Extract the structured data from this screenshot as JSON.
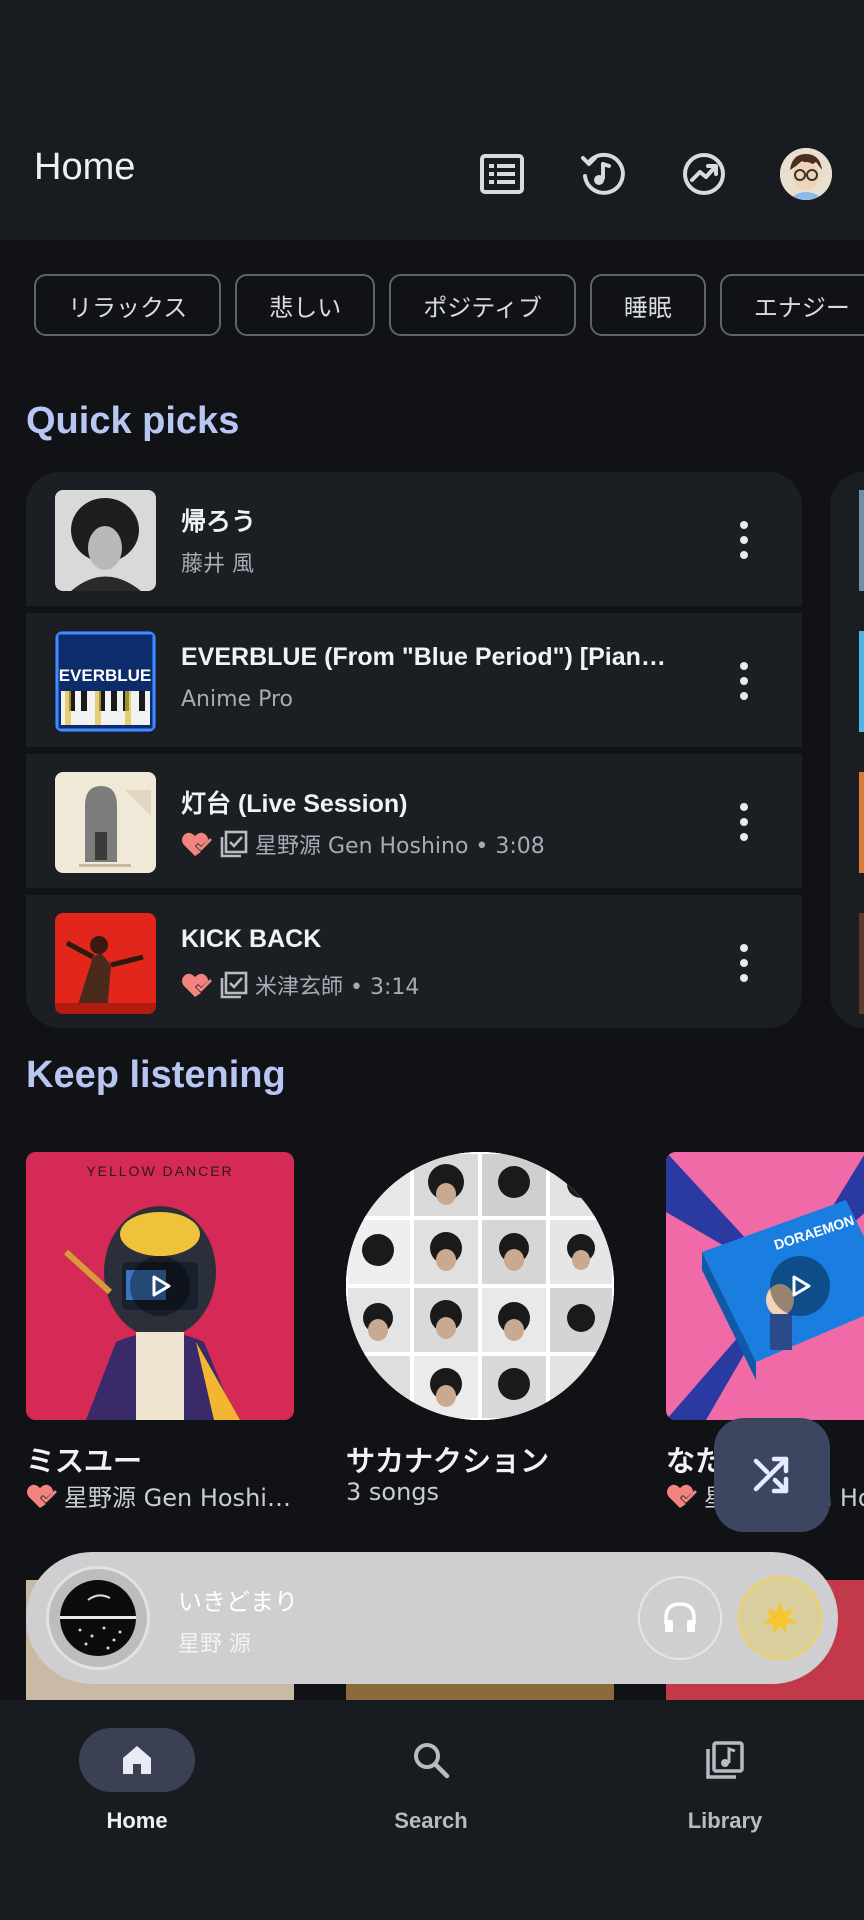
{
  "header": {
    "title": "Home",
    "icons": [
      "list-icon",
      "history-icon",
      "trending-icon",
      "avatar"
    ]
  },
  "chips": [
    "リラックス",
    "悲しい",
    "ポジティブ",
    "睡眠",
    "エナジー"
  ],
  "quick_picks": {
    "title": "Quick picks",
    "rows": [
      {
        "title": "帰ろう",
        "subtitle": "藤井 風",
        "liked": false
      },
      {
        "title": "EVERBLUE (From \"Blue Period\") [Piano Version]",
        "subtitle": "Anime Pro",
        "liked": false,
        "thumb_text": "EVERBLUE"
      },
      {
        "title": "灯台 (Live Session)",
        "subtitle": "星野源 Gen Hoshino • 3:08",
        "liked": true
      },
      {
        "title": "KICK BACK",
        "subtitle": "米津玄師 • 3:14",
        "liked": true
      }
    ]
  },
  "keep_listening": {
    "title": "Keep listening",
    "items": [
      {
        "title": "ミスユー",
        "subtitle": "星野源 Gen Hoshi…",
        "art_text": "YELLOW DANCER"
      },
      {
        "title": "サカナクション",
        "subtitle": "3 songs"
      },
      {
        "title": "なたのここ",
        "subtitle": "星野源 Gen Ho",
        "art_text": "DORAEMON"
      }
    ]
  },
  "mini_player": {
    "title": "いきどまり",
    "artist": "星野 源"
  },
  "nav": [
    {
      "label": "Home",
      "icon": "home-icon",
      "active": true
    },
    {
      "label": "Search",
      "icon": "search-icon",
      "active": false
    },
    {
      "label": "Library",
      "icon": "library-icon",
      "active": false
    }
  ],
  "colors": {
    "accent": "#b7c6f2",
    "background": "#101216",
    "surface": "#1a1d22",
    "liked": "#f2837f"
  }
}
